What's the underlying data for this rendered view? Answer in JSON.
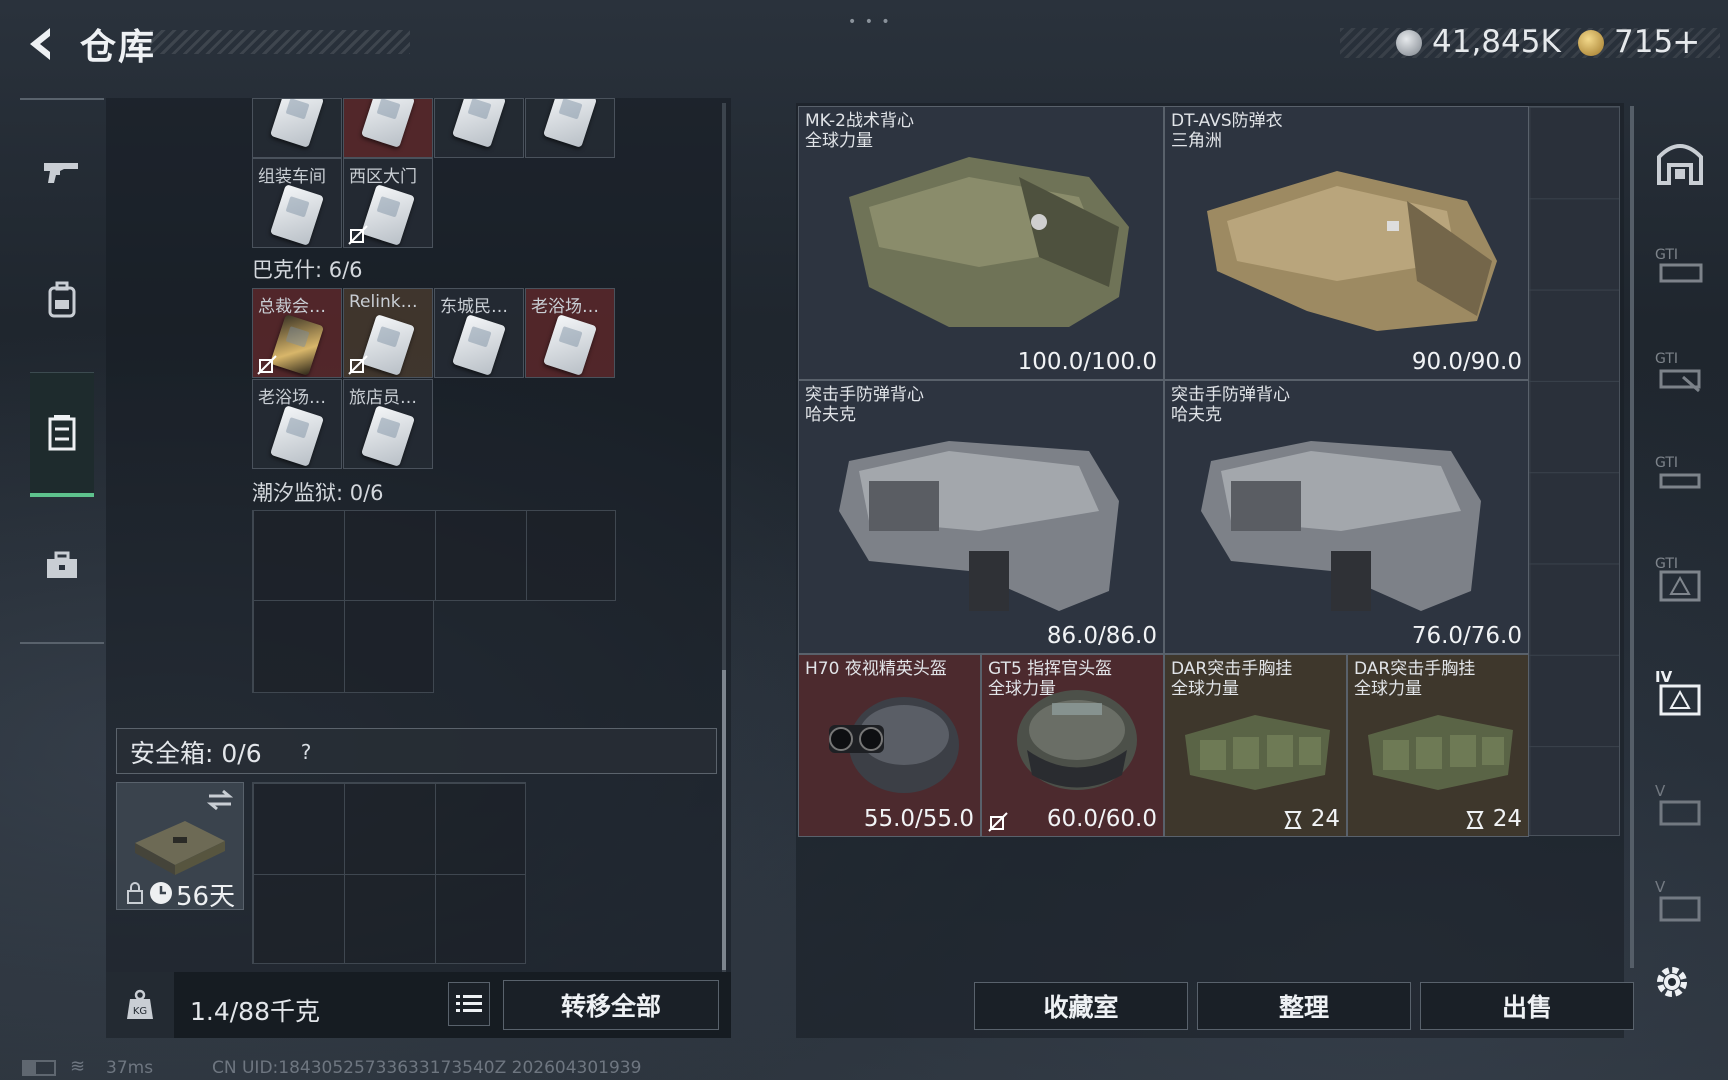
{
  "header": {
    "title": "仓库",
    "currency_silver": "41,845K",
    "currency_gold": "715",
    "add_label": "+"
  },
  "left_nav": {
    "items": [
      {
        "name": "weapons",
        "icon": "gun-icon"
      },
      {
        "name": "backpack",
        "icon": "backpack-icon"
      },
      {
        "name": "armor-container",
        "icon": "armor-box-icon",
        "active": true
      },
      {
        "name": "case",
        "icon": "toolbox-icon"
      }
    ]
  },
  "keys_top_row": [
    {
      "label": "",
      "bg": "gray"
    },
    {
      "label": "",
      "bg": "red"
    },
    {
      "label": "",
      "bg": "gray"
    },
    {
      "label": "",
      "bg": "gray"
    }
  ],
  "keys_row2": [
    {
      "label": "组装车间"
    },
    {
      "label": "西区大门"
    }
  ],
  "section_bakeshi": {
    "label": "巴克什: 6/6"
  },
  "keys_bakeshi": [
    {
      "label": "总裁会…"
    },
    {
      "label": "Relink…"
    },
    {
      "label": "东城民…"
    },
    {
      "label": "老浴场…"
    },
    {
      "label": "老浴场…"
    },
    {
      "label": "旅店员…"
    }
  ],
  "section_prison": {
    "label": "潮汐监狱: 0/6"
  },
  "safebox": {
    "label": "安全箱: 0/6",
    "help": "?",
    "days": "56天"
  },
  "bottom_left": {
    "weight": "1.4/88千克",
    "transfer_all": "转移全部"
  },
  "items": [
    {
      "line1": "MK-2战术背心",
      "line2": "全球力量",
      "durability": "100.0/100.0"
    },
    {
      "line1": "DT-AVS防弹衣",
      "line2": "三角洲",
      "durability": "90.0/90.0"
    },
    {
      "line1": "突击手防弹背心",
      "line2": "哈夫克",
      "durability": "86.0/86.0"
    },
    {
      "line1": "突击手防弹背心",
      "line2": "哈夫克",
      "durability": "76.0/76.0"
    },
    {
      "line1": "H70 夜视精英头盔",
      "line2": "",
      "durability": "55.0/55.0"
    },
    {
      "line1": "GT5 指挥官头盔",
      "line2": "全球力量",
      "durability": "60.0/60.0"
    },
    {
      "line1": "DAR突击手胸挂",
      "line2": "全球力量",
      "count": "24"
    },
    {
      "line1": "DAR突击手胸挂",
      "line2": "全球力量",
      "count": "24"
    }
  ],
  "bottom_right": {
    "collection": "收藏室",
    "sort": "整理",
    "sell": "出售"
  },
  "right_nav": {
    "tabs": [
      "all-gear",
      "GTI",
      "GTI",
      "GTI",
      "GTI",
      "IV",
      "V",
      "V"
    ],
    "labels": [
      "",
      "GTI",
      "GTI",
      "GTI",
      "GTI",
      "IV",
      "V",
      "V"
    ]
  },
  "status": {
    "ping": "37ms",
    "uid": "CN UID:18430525733633173540Z 202604301939"
  },
  "colors": {
    "accent_green": "#5ec28d",
    "rarity_red": "#4c2a2e",
    "rarity_tan": "#3e372c",
    "rarity_purple": "#2d3440"
  }
}
